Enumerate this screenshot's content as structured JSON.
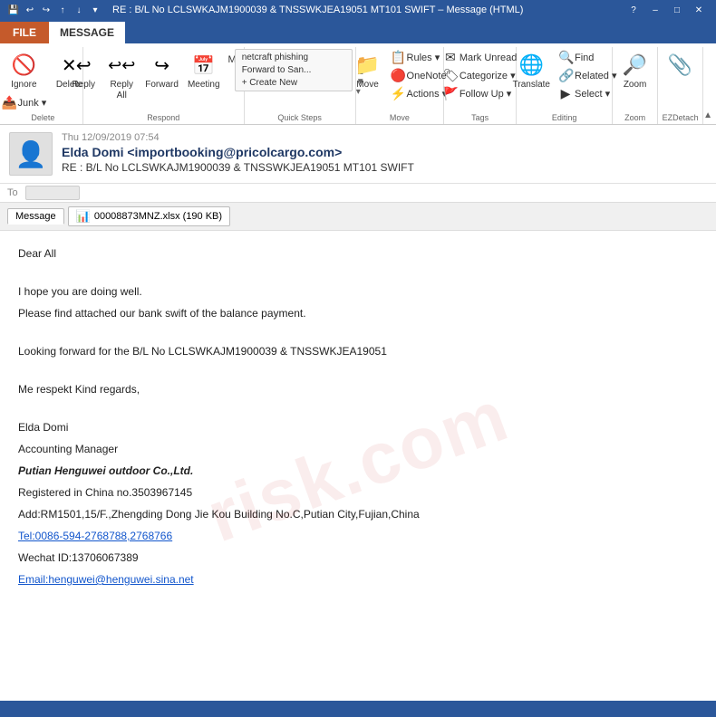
{
  "titlebar": {
    "title": "RE : B/L No LCLSWKAJM1900039 & TNSSWKJEA19051 MT101 SWIFT – Message (HTML)",
    "help_icon": "?",
    "minimize": "–",
    "maximize": "□",
    "close": "✕"
  },
  "tabs": {
    "file": "FILE",
    "message": "MESSAGE"
  },
  "ribbon": {
    "groups": [
      {
        "label": "Delete",
        "buttons_large": [
          {
            "icon": "🚫",
            "label": "Ignore"
          },
          {
            "icon": "✕",
            "label": "Delete"
          }
        ],
        "buttons_small": [
          {
            "icon": "📤",
            "label": "Junk ▾"
          }
        ]
      },
      {
        "label": "Respond",
        "buttons_large": [
          {
            "icon": "↩",
            "label": "Reply"
          },
          {
            "icon": "↩↩",
            "label": "Reply\nAll"
          },
          {
            "icon": "→",
            "label": "Forward"
          },
          {
            "icon": "📅",
            "label": "Meeting"
          }
        ],
        "buttons_small": [
          {
            "icon": "...",
            "label": "More ▾"
          }
        ]
      },
      {
        "label": "Quick Steps",
        "items": [
          "netcraft phishing",
          "Forward to San...",
          "Create New"
        ]
      },
      {
        "label": "Move",
        "buttons_large": [
          {
            "icon": "📁",
            "label": "Move"
          }
        ],
        "buttons_small": [
          {
            "icon": "📋",
            "label": "Rules ▾"
          },
          {
            "icon": "🔴",
            "label": "OneNote"
          },
          {
            "icon": "⚡",
            "label": "Actions ▾"
          }
        ]
      },
      {
        "label": "Tags",
        "buttons_small": [
          {
            "icon": "✉",
            "label": "Mark Unread"
          },
          {
            "icon": "🏷",
            "label": "Categorize ▾"
          },
          {
            "icon": "🚩",
            "label": "Follow Up ▾"
          }
        ]
      },
      {
        "label": "Editing",
        "buttons_large": [
          {
            "icon": "🌐",
            "label": "Translate"
          }
        ],
        "buttons_small": [
          {
            "icon": "🔍",
            "label": "Find"
          },
          {
            "icon": "🔗",
            "label": "Related ▾"
          },
          {
            "icon": "▶",
            "label": "Select ▾"
          }
        ]
      },
      {
        "label": "Zoom",
        "buttons_large": [
          {
            "icon": "🔎",
            "label": "Zoom"
          }
        ]
      },
      {
        "label": "EZDetach",
        "buttons_large": [
          {
            "icon": "📎",
            "label": ""
          }
        ]
      }
    ]
  },
  "email": {
    "to_label": "To",
    "to_value": "",
    "date": "Thu 12/09/2019 07:54",
    "from": "Elda Domi <importbooking@pricolcargo.com>",
    "subject": "RE : B/L No LCLSWKAJM1900039 & TNSSWKJEA19051 MT101 SWIFT",
    "tabs": {
      "message": "Message",
      "attachment": "00008873MNZ.xlsx (190 KB)"
    },
    "body": {
      "greeting": "Dear All",
      "line1": "I hope you are doing well.",
      "line2": "Please find attached our bank swift of the balance payment.",
      "line3": "Looking forward for the B/L No LCLSWKAJM1900039 & TNSSWKJEA19051",
      "line4": "Me respekt  Kind regards,",
      "signature_name": "Elda Domi",
      "signature_title": "Accounting Manager",
      "signature_company": "Putian Henguwei outdoor Co.,Ltd.",
      "signature_reg": "Registered in China no.3503967145",
      "signature_add": "Add:RM1501,15/F.,Zhengding Dong Jie Kou Building No.C,Putian City,Fujian,China",
      "signature_tel": "Tel:0086-594-2768788,2768766",
      "signature_wechat": "Wechat ID:13706067389",
      "signature_email": "Email:henguwei@henguwei.sina.net"
    }
  },
  "watermark": "risk.com",
  "status_bar": ""
}
